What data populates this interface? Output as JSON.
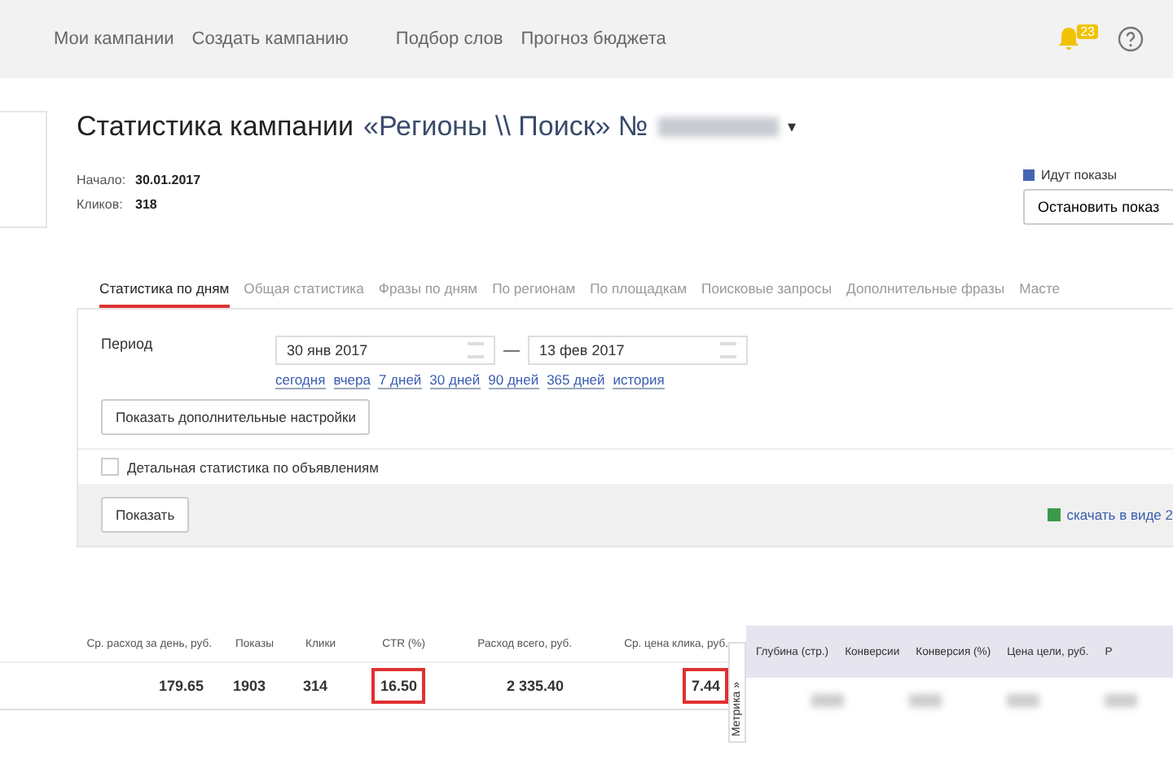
{
  "top_nav": {
    "links": [
      "Мои кампании",
      "Создать кампанию",
      "Подбор слов",
      "Прогноз бюджета"
    ],
    "notification_count": "23"
  },
  "header": {
    "title": "Статистика кампании",
    "campaign": "«Регионы \\\\ Поиск» №",
    "caret": "▾"
  },
  "info": [
    {
      "label": "Начало:",
      "value": "30.01.2017"
    },
    {
      "label": "Кликов:",
      "value": "318"
    }
  ],
  "status": {
    "text": "Идут показы",
    "button": "Остановить показ"
  },
  "tabs": [
    {
      "label": "Статистика по дням",
      "selected": true
    },
    {
      "label": "Общая статистика",
      "selected": false
    },
    {
      "label": "Фразы по дням",
      "selected": false
    },
    {
      "label": "По регионам",
      "selected": false
    },
    {
      "label": "По площадкам",
      "selected": false
    },
    {
      "label": "Поисковые запросы",
      "selected": false
    },
    {
      "label": "Дополнительные фразы",
      "selected": false
    },
    {
      "label": "Масте",
      "selected": false
    }
  ],
  "period": {
    "label": "Период",
    "from": "30 янв 2017",
    "dash": "—",
    "to": "13 фев 2017",
    "quick_links": [
      "сегодня",
      "вчера",
      "7 дней",
      "30 дней",
      "90 дней",
      "365 дней",
      "история"
    ]
  },
  "settings_button": "Показать дополнительные настройки",
  "detail_checkbox": {
    "label": "Детальная статистика по объявлениям",
    "checked": false
  },
  "show_button": "Показать",
  "download_link": "скачать в виде 2",
  "table": {
    "columns": [
      "Ср. расход за день, руб.",
      "Показы",
      "Клики",
      "CTR (%)",
      "Расход всего, руб.",
      "Ср. цена клика, руб."
    ],
    "cells": [
      {
        "text": "179.65",
        "highlighted": false
      },
      {
        "text": "1903",
        "highlighted": false
      },
      {
        "text": "314",
        "highlighted": false
      },
      {
        "text": "16.50",
        "highlighted": true
      },
      {
        "text": "2 335.40",
        "highlighted": false
      },
      {
        "text": "7.44",
        "highlighted": true
      }
    ],
    "metrika_tab": "Метрика »",
    "metrika_columns": [
      "Глубина (стр.)",
      "Конверсии",
      "Конверсия (%)",
      "Цена цели, руб.",
      "Р"
    ]
  }
}
